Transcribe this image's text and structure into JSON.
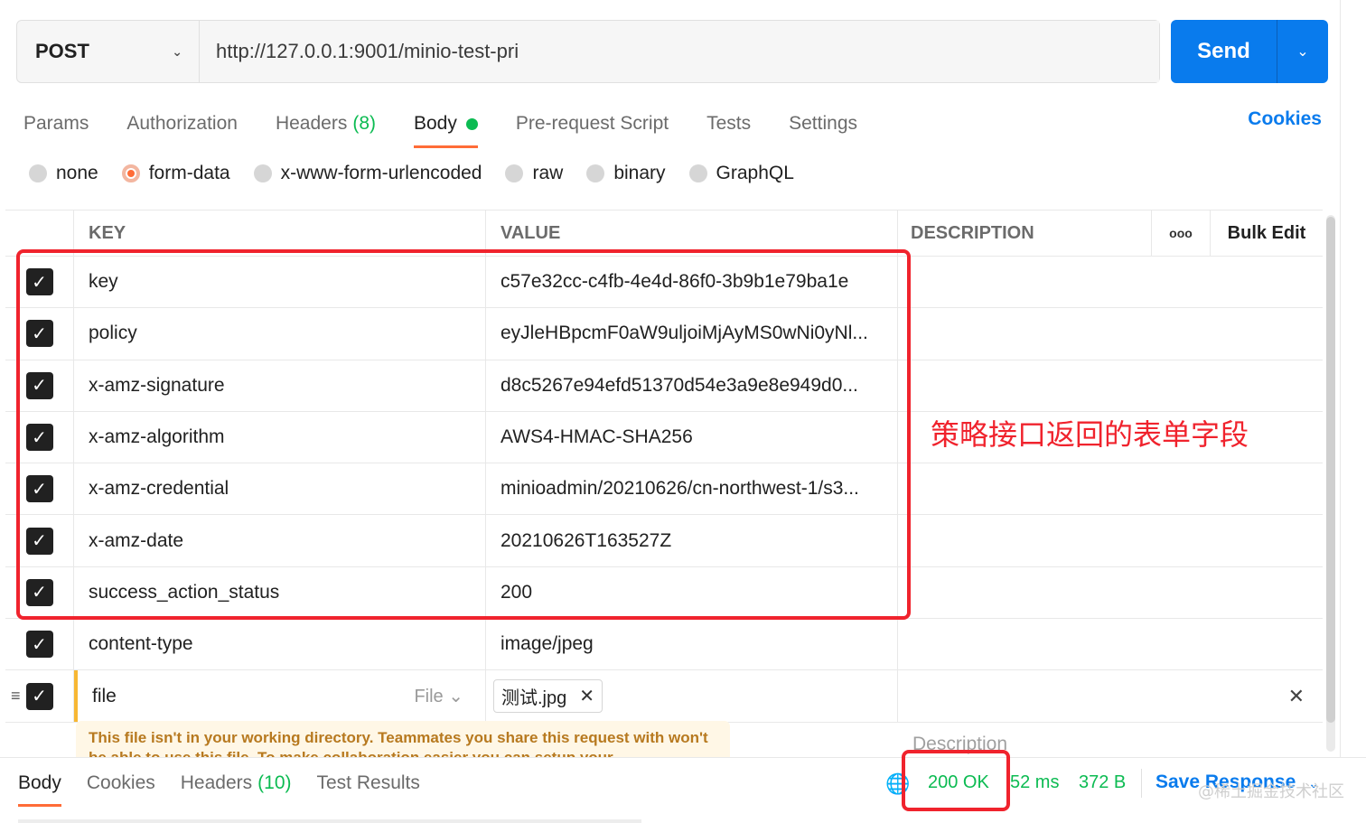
{
  "request": {
    "method": "POST",
    "url": "http://127.0.0.1:9001/minio-test-pri",
    "send_label": "Send"
  },
  "request_tabs": [
    {
      "label": "Params",
      "count": ""
    },
    {
      "label": "Authorization",
      "count": ""
    },
    {
      "label": "Headers",
      "count": "(8)"
    },
    {
      "label": "Body",
      "count": ""
    },
    {
      "label": "Pre-request Script",
      "count": ""
    },
    {
      "label": "Tests",
      "count": ""
    },
    {
      "label": "Settings",
      "count": ""
    }
  ],
  "cookies_label": "Cookies",
  "body_types": [
    "none",
    "form-data",
    "x-www-form-urlencoded",
    "raw",
    "binary",
    "GraphQL"
  ],
  "body_type_selected": "form-data",
  "table": {
    "headers": {
      "key": "KEY",
      "value": "VALUE",
      "description": "DESCRIPTION",
      "more": "ooo",
      "bulk_edit": "Bulk Edit"
    },
    "rows": [
      {
        "key": "key",
        "value": "c57e32cc-c4fb-4e4d-86f0-3b9b1e79ba1e"
      },
      {
        "key": "policy",
        "value": "eyJleHBpcmF0aW9uljoiMjAyMS0wNi0yNl..."
      },
      {
        "key": "x-amz-signature",
        "value": "d8c5267e94efd51370d54e3a9e8e949d0..."
      },
      {
        "key": "x-amz-algorithm",
        "value": "AWS4-HMAC-SHA256"
      },
      {
        "key": "x-amz-credential",
        "value": "minioadmin/20210626/cn-northwest-1/s3..."
      },
      {
        "key": "x-amz-date",
        "value": "20210626T163527Z"
      },
      {
        "key": "success_action_status",
        "value": "200"
      },
      {
        "key": "content-type",
        "value": "image/jpeg"
      }
    ],
    "file_row": {
      "key": "file",
      "type": "File",
      "file_name": "测试.jpg"
    },
    "description_placeholder": "Description"
  },
  "warning": "This file isn't in your working directory. Teammates you share this request with won't be able to use this file. To make collaboration easier you can setup your",
  "response": {
    "tabs": [
      {
        "label": "Body",
        "count": ""
      },
      {
        "label": "Cookies",
        "count": ""
      },
      {
        "label": "Headers",
        "count": "(10)"
      },
      {
        "label": "Test Results",
        "count": ""
      }
    ],
    "status": "200 OK",
    "time": "52 ms",
    "size": "372 B",
    "save_label": "Save Response"
  },
  "annotation": "策略接口返回的表单字段",
  "watermark": "@稀土掘金技术社区",
  "colors": {
    "accent": "#097bed",
    "active_tab": "#ff6c37",
    "success": "#0cbb52",
    "annotation": "#f0232d"
  }
}
